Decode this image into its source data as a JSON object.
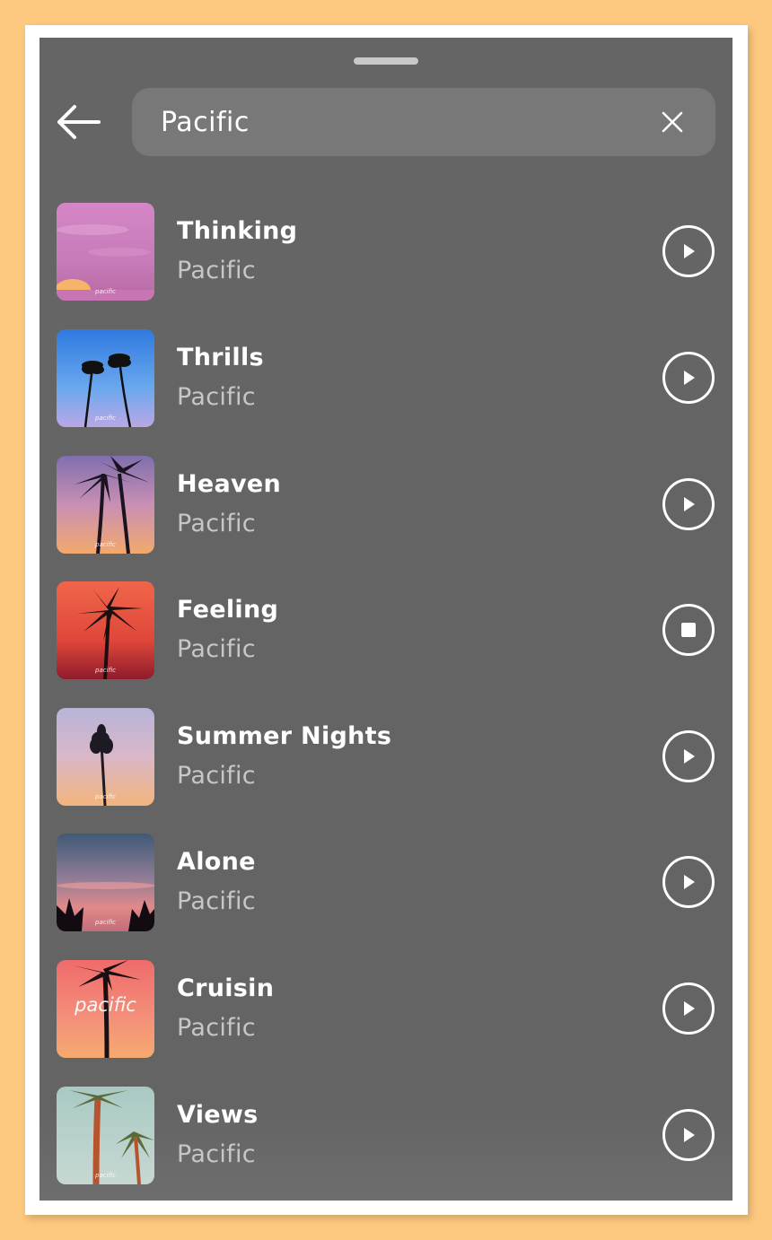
{
  "search": {
    "value": "Pacific",
    "back_icon": "arrow-left-icon",
    "clear_icon": "close-icon"
  },
  "tracks": [
    {
      "title": "Thinking",
      "artist": "Pacific",
      "state": "play",
      "art_label": "pacific"
    },
    {
      "title": "Thrills",
      "artist": "Pacific",
      "state": "play",
      "art_label": "pacific"
    },
    {
      "title": "Heaven",
      "artist": "Pacific",
      "state": "play",
      "art_label": "pacific"
    },
    {
      "title": "Feeling",
      "artist": "Pacific",
      "state": "stop",
      "art_label": "pacific"
    },
    {
      "title": "Summer Nights",
      "artist": "Pacific",
      "state": "play",
      "art_label": "pacific"
    },
    {
      "title": "Alone",
      "artist": "Pacific",
      "state": "play",
      "art_label": "pacific"
    },
    {
      "title": "Cruisin",
      "artist": "Pacific",
      "state": "play",
      "art_label": "pacific"
    },
    {
      "title": "Views",
      "artist": "Pacific",
      "state": "play",
      "art_label": "pacific"
    }
  ],
  "colors": {
    "background": "#FDC87F",
    "panel": "#656565",
    "search_box": "#787878",
    "title_text": "#FFFFFF",
    "artist_text": "#C7C7C7"
  }
}
